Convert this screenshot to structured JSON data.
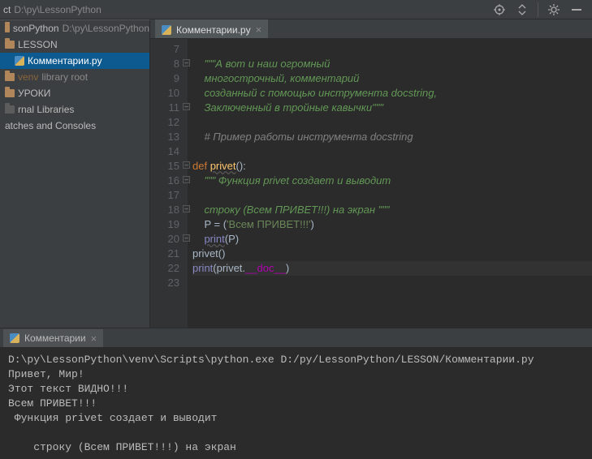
{
  "topbar": {
    "project_label": "ct",
    "path": "D:\\py\\LessonPython",
    "icons": [
      "target",
      "collapse",
      "divider",
      "gear",
      "hide"
    ]
  },
  "sidebar": {
    "items": [
      {
        "kind": "folder",
        "label": "sonPython",
        "suffix": "D:\\py\\LessonPython"
      },
      {
        "kind": "folder",
        "label": "LESSON"
      },
      {
        "kind": "pyfile",
        "label": "Комментарии.py",
        "selected": true
      },
      {
        "kind": "folder",
        "label": "venv",
        "suffix": "library root",
        "dim": true
      },
      {
        "kind": "folder",
        "label": "УРОКИ"
      },
      {
        "kind": "lib",
        "label": "rnal Libraries"
      },
      {
        "kind": "text",
        "label": "atches and Consoles"
      }
    ]
  },
  "tab": {
    "label": "Комментарии.py"
  },
  "code": {
    "first_line": 7,
    "lines": [
      {
        "n": 7,
        "html": ""
      },
      {
        "n": 8,
        "html": "    <span class='tok-doc'>\"\"\"А вот и наш огромный</span>",
        "fold": true
      },
      {
        "n": 9,
        "html": "    <span class='tok-doc'>многострочный, комментарий</span>"
      },
      {
        "n": 10,
        "html": "    <span class='tok-doc'>созданный с помощью инструмента docstring,</span>"
      },
      {
        "n": 11,
        "html": "    <span class='tok-doc'>Заключенный в тройные кавычки\"\"\"</span>",
        "fold": true
      },
      {
        "n": 12,
        "html": ""
      },
      {
        "n": 13,
        "html": "    <span class='tok-com'># Пример работы инструмента docstring</span>"
      },
      {
        "n": 14,
        "html": ""
      },
      {
        "n": 15,
        "html": "<span class='tok-kw'>def</span> <span class='tok-fn'>privet</span><span class='code-default'>():</span>",
        "fold": true
      },
      {
        "n": 16,
        "html": "    <span class='tok-doc'>\"\"\" Функция privet создает и выводит</span>",
        "fold": true
      },
      {
        "n": 17,
        "html": ""
      },
      {
        "n": 18,
        "html": "    <span class='tok-doc'>строку (Всем ПРИВЕТ!!!) на экран \"\"\"</span>",
        "fold": true
      },
      {
        "n": 19,
        "html": "    <span class='code-default'>P = (</span><span class='tok-str'>'Всем ПРИВЕТ!!!'</span><span class='code-default'>)</span>"
      },
      {
        "n": 20,
        "html": "    <span class='tok-builtin wavy'>print</span><span class='code-default'>(P)</span>",
        "fold": true
      },
      {
        "n": 21,
        "html": "<span class='tok-call'>privet</span><span class='code-default'>()</span>"
      },
      {
        "n": 22,
        "html": "<span class='tok-builtin'>print</span><span class='code-default'>(privet.</span><span class='tok-dunder'>__doc__</span><span class='code-default'>)</span>",
        "current": true
      },
      {
        "n": 23,
        "html": ""
      }
    ]
  },
  "console": {
    "tab_label": "Комментарии",
    "output": "D:\\py\\LessonPython\\venv\\Scripts\\python.exe D:/py/LessonPython/LESSON/Комментарии.py\nПривет, Мир!\nЭтот текст ВИДНО!!!\nВсем ПРИВЕТ!!!\n Функция privet создает и выводит\n\n    строку (Всем ПРИВЕТ!!!) на экран \n"
  }
}
